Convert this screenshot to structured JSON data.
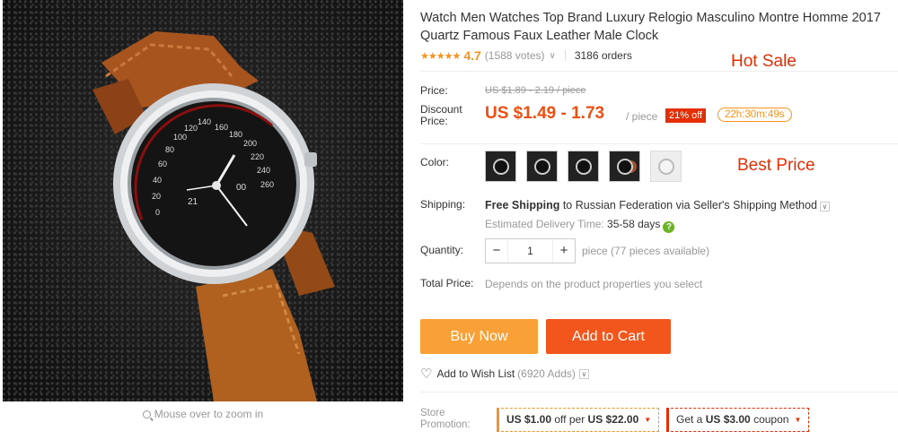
{
  "gallery": {
    "zoom_hint": "Mouse over to zoom in",
    "dial_numbers": [
      "0",
      "20",
      "40",
      "60",
      "80",
      "100",
      "120",
      "140",
      "160",
      "180",
      "200",
      "220",
      "240",
      "260"
    ],
    "dial_sub": "21",
    "dial_odometer": "00"
  },
  "product": {
    "title": "Watch Men Watches Top Brand Luxury Relogio Masculino Montre Homme 2017 Quartz Famous Faux Leather Male Clock",
    "rating_stars": "★★★★★",
    "rating_value": "4.7",
    "votes": "(1588 votes)",
    "orders": "3186 orders",
    "hot_sale": "Hot Sale"
  },
  "price": {
    "label": "Price:",
    "original": "US $1.89 - 2.19 / piece",
    "discount_label_1": "Discount",
    "discount_label_2": "Price:",
    "current": "US $1.49 - 1.73",
    "per_piece": "/ piece",
    "discount_badge": "21% off",
    "countdown": "22h:30m:49s"
  },
  "color": {
    "label": "Color:",
    "best_price": "Best Price"
  },
  "shipping": {
    "label": "Shipping:",
    "method_bold": "Free Shipping",
    "method_rest": " to Russian Federation via Seller's Shipping Method",
    "delivery_label": "Estimated Delivery Time: ",
    "delivery_days": "35-58 days"
  },
  "quantity": {
    "label": "Quantity:",
    "value": "1",
    "minus": "−",
    "plus": "+",
    "available": "piece (77 pieces available)"
  },
  "total": {
    "label": "Total Price:",
    "note": "Depends on the product properties you select"
  },
  "actions": {
    "buy_now": "Buy Now",
    "add_to_cart": "Add to Cart",
    "wishlist": "Add to Wish List",
    "wishlist_adds": "(6920 Adds)"
  },
  "promotion": {
    "label_1": "Store",
    "label_2": "Promotion:",
    "coupon1_amount": "US $1.00",
    "coupon1_mid": " off per ",
    "coupon1_min": "US $22.00",
    "coupon2_pre": "Get a ",
    "coupon2_amount": "US $3.00",
    "coupon2_post": " coupon"
  },
  "colors": {
    "accent": "#f04e10",
    "buy_now_bg": "#f9a036",
    "add_to_cart_bg": "#f2561c",
    "star": "#f7931e",
    "badge_red": "#e62e04"
  },
  "icons": {
    "search": "magnifier-icon",
    "heart": "heart-plus-icon",
    "chevron": "chevron-down-icon",
    "question": "question-icon"
  }
}
